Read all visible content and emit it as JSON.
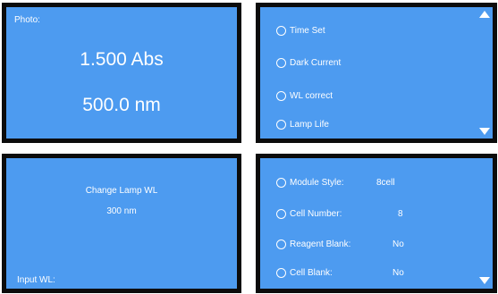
{
  "screen1": {
    "label": "Photo:",
    "absorbance": "1.500 Abs",
    "wavelength": "500.0 nm"
  },
  "screen2": {
    "options": [
      "Time Set",
      "Dark Current",
      "WL correct",
      "Lamp Life"
    ]
  },
  "screen3": {
    "title": "Change Lamp WL",
    "value": "300 nm",
    "input_label": "Input WL:"
  },
  "screen4": {
    "options": [
      {
        "label": "Module Style:",
        "value": "8cell"
      },
      {
        "label": "Cell Number:",
        "value": "8"
      },
      {
        "label": "Reagent Blank:",
        "value": "No"
      },
      {
        "label": "Cell Blank:",
        "value": "No"
      }
    ]
  },
  "colors": {
    "screen_bg": "#4d9bf0",
    "bezel": "#0c0c0c",
    "text": "#ffffff"
  }
}
